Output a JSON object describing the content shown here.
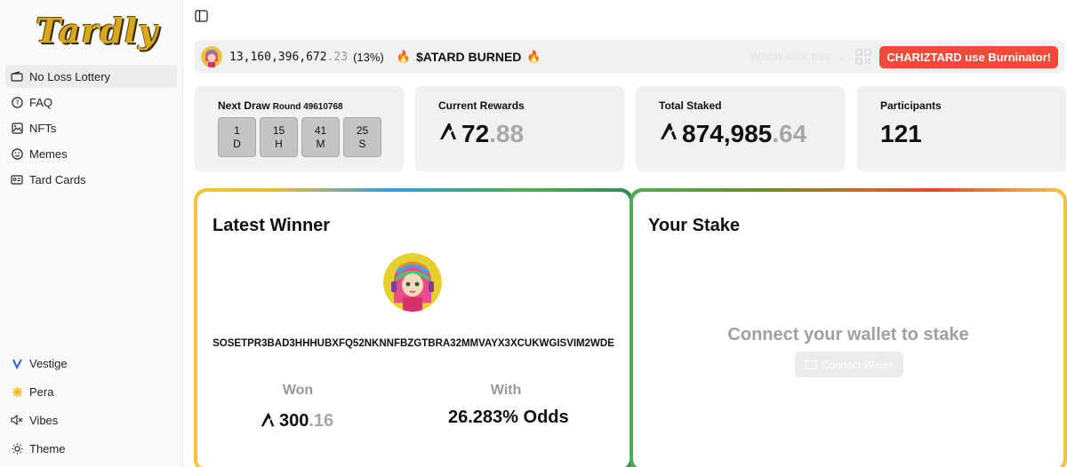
{
  "app": {
    "logo": "Tardly"
  },
  "sidebar": {
    "items": [
      {
        "label": "No Loss Lottery",
        "icon": "ticket-icon",
        "active": true
      },
      {
        "label": "FAQ",
        "icon": "question-circle-icon"
      },
      {
        "label": "NFTs",
        "icon": "images-icon"
      },
      {
        "label": "Memes",
        "icon": "smile-icon"
      },
      {
        "label": "Tard Cards",
        "icon": "id-card-icon"
      }
    ],
    "bottom": [
      {
        "label": "Vestige",
        "icon": "vestige-logo-icon"
      },
      {
        "label": "Pera",
        "icon": "pera-logo-icon"
      },
      {
        "label": "Vibes",
        "icon": "speaker-mute-icon"
      },
      {
        "label": "Theme",
        "icon": "sun-icon"
      }
    ]
  },
  "ticker": {
    "burned_int": "13,160,396,672",
    "burned_dec": ".23",
    "burned_pct": "(13%)",
    "burned_label": "$ATARD BURNED",
    "faded_text": "Words click this →",
    "cta_label": "CHARIZTARD use Burninator!"
  },
  "stats": {
    "next_draw": {
      "label": "Next Draw",
      "round": "Round 49610768",
      "timer": [
        {
          "value": "1",
          "unit": "D"
        },
        {
          "value": "15",
          "unit": "H"
        },
        {
          "value": "41",
          "unit": "M"
        },
        {
          "value": "25",
          "unit": "S"
        }
      ]
    },
    "current_rewards": {
      "label": "Current Rewards",
      "int": "72",
      "dec": ".88"
    },
    "total_staked": {
      "label": "Total Staked",
      "int": "874,985",
      "dec": ".64"
    },
    "participants": {
      "label": "Participants",
      "value": "121"
    }
  },
  "latest_winner": {
    "title": "Latest Winner",
    "address": "SOSETPR3BAD3HHHUBXFQ52NKNNFBZGTBRA32MMVAYX3XCUKWGISVIM2WDE",
    "won_label": "Won",
    "won_int": "300",
    "won_dec": ".16",
    "with_label": "With",
    "odds": "26.283% Odds"
  },
  "your_stake": {
    "title": "Your Stake",
    "message": "Connect your wallet to stake",
    "button": "Connect Wallet"
  },
  "currency_symbol": "A",
  "colors": {
    "accent_red": "#f04a3b",
    "logo_gold": "#d8a91c"
  }
}
